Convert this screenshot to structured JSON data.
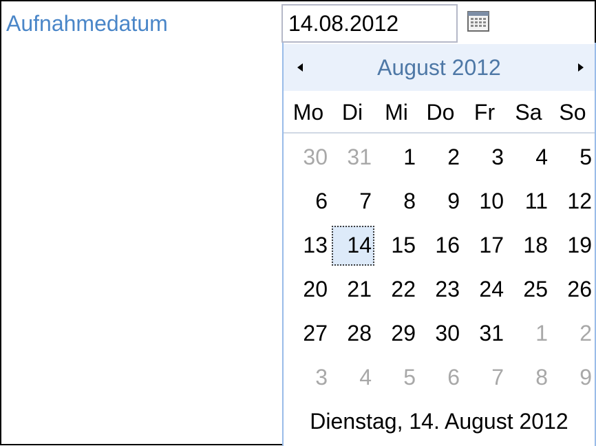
{
  "form": {
    "label": "Aufnahmedatum",
    "date_value": "14.08.2012",
    "trigger_icon": "calendar-icon"
  },
  "picker": {
    "prev_icon": "triangle-left-icon",
    "next_icon": "triangle-right-icon",
    "month_title": "August 2012",
    "weekdays": [
      "Mo",
      "Di",
      "Mi",
      "Do",
      "Fr",
      "Sa",
      "So"
    ],
    "weeks": [
      [
        {
          "d": "30",
          "other": true
        },
        {
          "d": "31",
          "other": true
        },
        {
          "d": "1"
        },
        {
          "d": "2"
        },
        {
          "d": "3"
        },
        {
          "d": "4"
        },
        {
          "d": "5"
        }
      ],
      [
        {
          "d": "6"
        },
        {
          "d": "7"
        },
        {
          "d": "8"
        },
        {
          "d": "9"
        },
        {
          "d": "10"
        },
        {
          "d": "11"
        },
        {
          "d": "12"
        }
      ],
      [
        {
          "d": "13"
        },
        {
          "d": "14",
          "selected": true
        },
        {
          "d": "15"
        },
        {
          "d": "16"
        },
        {
          "d": "17"
        },
        {
          "d": "18"
        },
        {
          "d": "19"
        }
      ],
      [
        {
          "d": "20"
        },
        {
          "d": "21"
        },
        {
          "d": "22"
        },
        {
          "d": "23"
        },
        {
          "d": "24"
        },
        {
          "d": "25"
        },
        {
          "d": "26"
        }
      ],
      [
        {
          "d": "27"
        },
        {
          "d": "28"
        },
        {
          "d": "29"
        },
        {
          "d": "30"
        },
        {
          "d": "31"
        },
        {
          "d": "1",
          "other": true
        },
        {
          "d": "2",
          "other": true
        }
      ],
      [
        {
          "d": "3",
          "other": true
        },
        {
          "d": "4",
          "other": true
        },
        {
          "d": "5",
          "other": true
        },
        {
          "d": "6",
          "other": true
        },
        {
          "d": "7",
          "other": true
        },
        {
          "d": "8",
          "other": true
        },
        {
          "d": "9",
          "other": true
        }
      ]
    ],
    "footer": "Dienstag, 14. August 2012"
  },
  "colors": {
    "label": "#4a86c8",
    "month_title": "#4e78a6",
    "header_bg": "#eaf1fb",
    "selected_bg": "#ddeaf9",
    "other_month": "#a8a8a8"
  }
}
